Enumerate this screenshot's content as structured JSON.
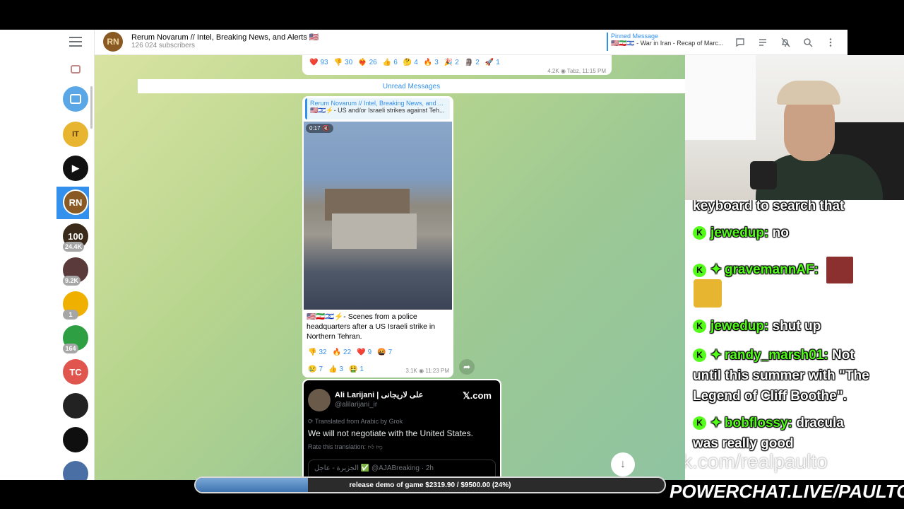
{
  "channel": {
    "avatar_initials": "RN",
    "title": "Rerum Novarum // Intel, Breaking News, and Alerts 🇺🇸",
    "subscribers": "126 024 subscribers"
  },
  "pinned": {
    "label": "Pinned Message",
    "text": "🇺🇸🇮🇷🇮🇱 - War in Iran - Recap of Marc..."
  },
  "header_icons": [
    "chat-icon",
    "list-icon",
    "bell-off-icon",
    "search-icon",
    "more-icon"
  ],
  "sidebar": {
    "items": [
      {
        "initials": "IT",
        "color": "#e8b530"
      },
      {
        "initials": "▶",
        "color": "#111111",
        "badge": ""
      },
      {
        "initials": "RN",
        "color": "#8a5a24"
      },
      {
        "initials": "100",
        "color": "#3a2a1a",
        "badge": "24.4K"
      },
      {
        "initials": "",
        "color": "#5a3a3a",
        "badge": "9.2K"
      },
      {
        "initials": "",
        "color": "#f0b000",
        "badge": "1"
      },
      {
        "initials": "",
        "color": "#2ea043",
        "badge": "164"
      },
      {
        "initials": "TC",
        "color": "#e0564e"
      },
      {
        "initials": "",
        "color": "#222222"
      },
      {
        "initials": "",
        "color": "#0f0f0f"
      },
      {
        "initials": "",
        "color": "#4a6fa5"
      }
    ]
  },
  "prev_message": {
    "reactions": [
      {
        "emoji": "❤️",
        "count": "93"
      },
      {
        "emoji": "👎",
        "count": "30"
      },
      {
        "emoji": "❤️‍🔥",
        "count": "26"
      },
      {
        "emoji": "👍",
        "count": "6"
      },
      {
        "emoji": "🤔",
        "count": "4"
      },
      {
        "emoji": "🔥",
        "count": "3"
      },
      {
        "emoji": "🎉",
        "count": "2"
      },
      {
        "emoji": "🗿",
        "count": "2"
      },
      {
        "emoji": "🚀",
        "count": "1"
      }
    ],
    "views": "4.2K",
    "time": "Tabz, 11:15 PM"
  },
  "unread_label": "Unread Messages",
  "video_message": {
    "reply_title": "Rerum Novarum // Intel, Breaking News, and ...",
    "reply_text": "🇺🇸🇮🇱⚡- US and/or Israeli strikes against Teh...",
    "duration": "0:17",
    "caption": "🇺🇸🇮🇷🇮🇱⚡- Scenes from a police headquarters after a US Israeli strike in Northern Tehran.",
    "reactions_row1": [
      {
        "emoji": "👎",
        "count": "32"
      },
      {
        "emoji": "🔥",
        "count": "22"
      },
      {
        "emoji": "❤️",
        "count": "9"
      },
      {
        "emoji": "🤬",
        "count": "7"
      }
    ],
    "reactions_row2": [
      {
        "emoji": "😢",
        "count": "7"
      },
      {
        "emoji": "👍",
        "count": "3"
      },
      {
        "emoji": "🤮",
        "count": "1"
      }
    ],
    "views": "3.1K",
    "time": "11:23 PM"
  },
  "x_post": {
    "name": "Ali Larijani | علی لاریجانی",
    "handle": "@alilarijani_ir",
    "brand": "𝕏.com",
    "translated_note": "Translated from Arabic by Grok",
    "text": "We will not negotiate with the United States.",
    "rate": "Rate this translation:",
    "quote": "الجزيرة - عاجل ✅ @AJABreaking · 2h"
  },
  "stream_chat": [
    {
      "kind": "cont",
      "text": "keyboard to search that"
    },
    {
      "kind": "msg",
      "user": "jewedup:",
      "text": "no",
      "star": false
    },
    {
      "kind": "msg",
      "user": "gravemannAF:",
      "text": "",
      "star": true
    },
    {
      "kind": "msg",
      "user": "jewedup:",
      "text": "shut up",
      "star": false
    },
    {
      "kind": "msg",
      "user": "randy_marsh01:",
      "text": "Not",
      "star": true
    },
    {
      "kind": "cont",
      "text": "until this summer with \"The"
    },
    {
      "kind": "cont",
      "text": "Legend of Cliff Boothe\"."
    },
    {
      "kind": "msg",
      "user": "bobflossy:",
      "text": "dracula",
      "star": true
    },
    {
      "kind": "cont",
      "text": "was really good"
    }
  ],
  "kick_url": "kick.com/realpaulto",
  "donation": {
    "text": "release demo of game $2319.90 / $9500.00 (24%)",
    "progress": 0.24
  },
  "powerchat": "POWERCHAT.LIVE/PAULTOWN",
  "colors": {
    "accent": "#3390ec",
    "kick_green": "#53fc18"
  }
}
